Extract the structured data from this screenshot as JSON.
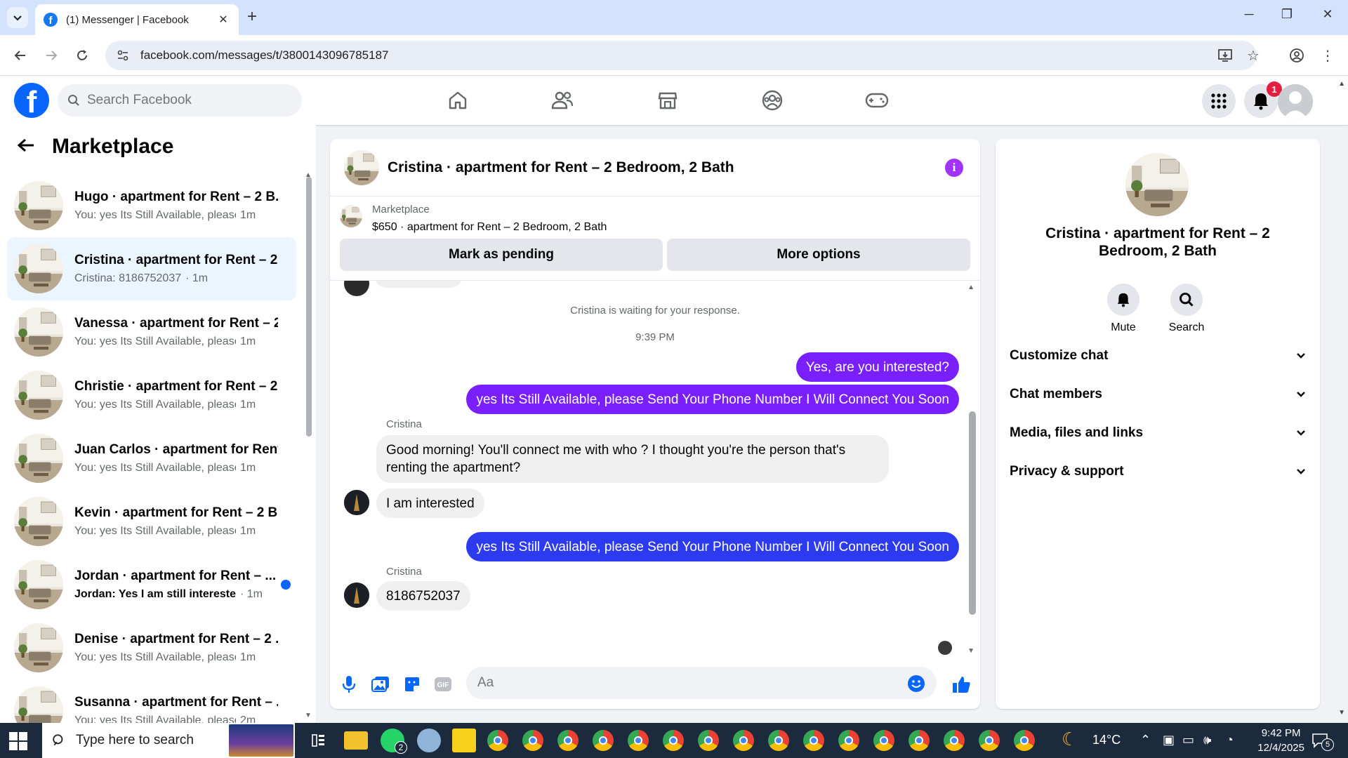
{
  "browser": {
    "tab_title": "(1) Messenger | Facebook",
    "url": "facebook.com/messages/t/3800143096785187"
  },
  "fb": {
    "search_placeholder": "Search Facebook",
    "notification_count": "1"
  },
  "sidebar": {
    "title": "Marketplace",
    "conversations": [
      {
        "name": "Hugo · apartment for Rent – 2 B...",
        "preview": "You: yes Its Still Available, please S...",
        "time": "1m",
        "unread": false,
        "active": false
      },
      {
        "name": "Cristina · apartment for Rent – 2...",
        "preview": "Cristina: 8186752037",
        "time": "· 1m",
        "unread": false,
        "active": true
      },
      {
        "name": "Vanessa · apartment for Rent – 2...",
        "preview": "You: yes Its Still Available, please S...",
        "time": "1m",
        "unread": false,
        "active": false
      },
      {
        "name": "Christie · apartment for Rent – 2...",
        "preview": "You: yes Its Still Available, please S...",
        "time": "1m",
        "unread": false,
        "active": false
      },
      {
        "name": "Juan Carlos · apartment for Rent...",
        "preview": "You: yes Its Still Available, please S...",
        "time": "1m",
        "unread": false,
        "active": false
      },
      {
        "name": "Kevin · apartment for Rent – 2 B...",
        "preview": "You: yes Its Still Available, please S...",
        "time": "1m",
        "unread": false,
        "active": false
      },
      {
        "name": "Jordan · apartment for Rent – ...",
        "preview": "Jordan: Yes I am still interested ...",
        "time": "· 1m",
        "unread": true,
        "active": false
      },
      {
        "name": "Denise · apartment for Rent – 2 ...",
        "preview": "You: yes Its Still Available, please S...",
        "time": "1m",
        "unread": false,
        "active": false
      },
      {
        "name": "Susanna · apartment for Rent – ...",
        "preview": "You: yes Its Still Available, please S...",
        "time": "2m",
        "unread": false,
        "active": false
      }
    ]
  },
  "chat": {
    "title": "Cristina · apartment for Rent – 2 Bedroom, 2 Bath",
    "marketplace_label": "Marketplace",
    "listing": "$650 · apartment for Rent – 2 Bedroom, 2 Bath",
    "mark_pending": "Mark as pending",
    "more_options": "More options",
    "waiting": "Cristina is waiting for your response.",
    "timestamp": "9:39 PM",
    "messages": {
      "m1": "Yes, are you interested?",
      "m2": "yes Its Still Available, please Send Your Phone Number I Will Connect You Soon",
      "sender1": "Cristina",
      "m3": "Good morning! You'll connect me with who ? I thought you're the person that's renting the apartment?",
      "m4": "I am interested",
      "m5": "yes Its Still Available, please Send Your Phone Number I Will Connect You Soon",
      "sender2": "Cristina",
      "m6": "8186752037"
    },
    "composer_placeholder": "Aa"
  },
  "info_panel": {
    "title": "Cristina · apartment for Rent – 2 Bedroom, 2 Bath",
    "mute": "Mute",
    "search": "Search",
    "sections": [
      "Customize chat",
      "Chat members",
      "Media, files and links",
      "Privacy & support"
    ]
  },
  "taskbar": {
    "search_placeholder": "Type here to search",
    "weather": "14°C",
    "time": "9:42 PM",
    "date": "12/4/2025",
    "notif_count": "5",
    "whatsapp_badge": "2"
  },
  "colors": {
    "outgoing_bubble_purple": "#7a1fff",
    "outgoing_bubble_blue": "#2c3bf0",
    "fb_blue": "#0866ff",
    "active_conv_bg": "#ebf5ff"
  }
}
